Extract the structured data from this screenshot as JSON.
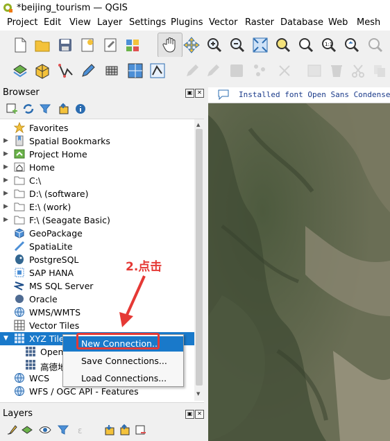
{
  "window": {
    "title": "*beijing_tourism — QGIS"
  },
  "menu": [
    "Project",
    "Edit",
    "View",
    "Layer",
    "Settings",
    "Plugins",
    "Vector",
    "Raster",
    "Database",
    "Web",
    "Mesh"
  ],
  "browser": {
    "title": "Browser",
    "items": [
      {
        "label": "Favorites",
        "icon": "star-icon",
        "arrow": "",
        "indent": 0
      },
      {
        "label": "Spatial Bookmarks",
        "icon": "bookmark-icon",
        "arrow": "▶",
        "indent": 0
      },
      {
        "label": "Project Home",
        "icon": "project-home-icon",
        "arrow": "▶",
        "indent": 0
      },
      {
        "label": "Home",
        "icon": "home-icon",
        "arrow": "▶",
        "indent": 0
      },
      {
        "label": "C:\\",
        "icon": "folder-icon",
        "arrow": "▶",
        "indent": 0
      },
      {
        "label": "D:\\ (software)",
        "icon": "folder-icon",
        "arrow": "▶",
        "indent": 0
      },
      {
        "label": "E:\\ (work)",
        "icon": "folder-icon",
        "arrow": "▶",
        "indent": 0
      },
      {
        "label": "F:\\ (Seagate Basic)",
        "icon": "folder-icon",
        "arrow": "▶",
        "indent": 0
      },
      {
        "label": "GeoPackage",
        "icon": "geopackage-icon",
        "arrow": "",
        "indent": 0
      },
      {
        "label": "SpatiaLite",
        "icon": "spatialite-icon",
        "arrow": "",
        "indent": 0
      },
      {
        "label": "PostgreSQL",
        "icon": "postgresql-icon",
        "arrow": "",
        "indent": 0
      },
      {
        "label": "SAP HANA",
        "icon": "sap-hana-icon",
        "arrow": "",
        "indent": 0
      },
      {
        "label": "MS SQL Server",
        "icon": "mssql-icon",
        "arrow": "",
        "indent": 0
      },
      {
        "label": "Oracle",
        "icon": "oracle-icon",
        "arrow": "",
        "indent": 0
      },
      {
        "label": "WMS/WMTS",
        "icon": "wms-icon",
        "arrow": "",
        "indent": 0
      },
      {
        "label": "Vector Tiles",
        "icon": "vector-tiles-icon",
        "arrow": "",
        "indent": 0
      },
      {
        "label": "XYZ Tiles",
        "icon": "xyz-tiles-icon",
        "arrow": "▼",
        "indent": 0,
        "selected": true
      },
      {
        "label": "Open",
        "icon": "xyz-tiles-icon",
        "arrow": "",
        "indent": 1
      },
      {
        "label": "高德地",
        "icon": "xyz-tiles-icon",
        "arrow": "",
        "indent": 1
      },
      {
        "label": "WCS",
        "icon": "wcs-icon",
        "arrow": "",
        "indent": 0
      },
      {
        "label": "WFS / OGC API - Features",
        "icon": "wfs-icon",
        "arrow": "",
        "indent": 0
      }
    ]
  },
  "context_menu": {
    "items": [
      "New Connection...",
      "Save Connections...",
      "Load Connections..."
    ]
  },
  "annotation": "2.点击",
  "notice": {
    "text": "Installed font Open Sans Condensed Li"
  },
  "layers": {
    "title": "Layers"
  },
  "colors": {
    "selection": "#1979ca",
    "annotation": "#e53935"
  }
}
